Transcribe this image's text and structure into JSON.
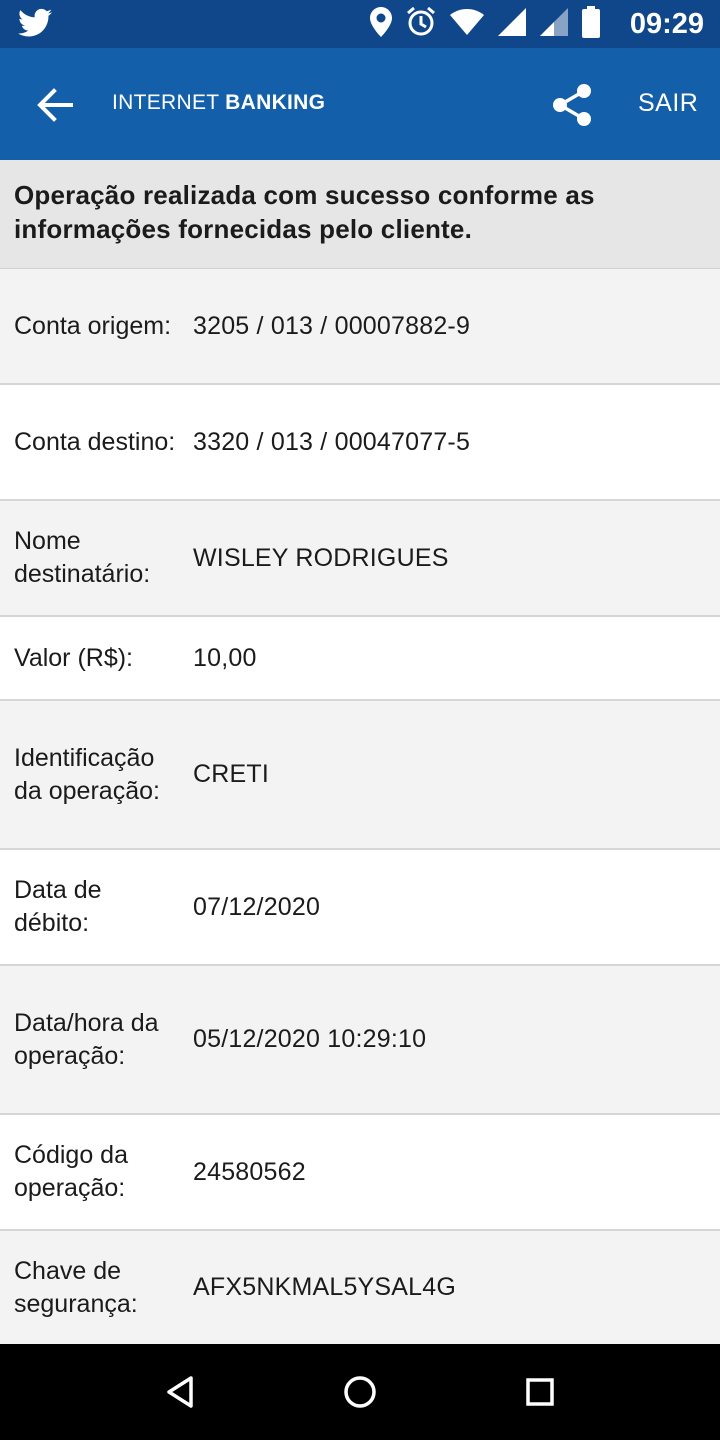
{
  "status_bar": {
    "time": "09:29",
    "icons": [
      "twitter-icon",
      "location-icon",
      "alarm-icon",
      "wifi-icon",
      "signal-icon",
      "signal-icon",
      "battery-icon"
    ]
  },
  "app_bar": {
    "title_prefix": "INTERNET",
    "title_bold": "BANKING",
    "exit_label": "SAIR",
    "colors": {
      "status_bar": "#10478a",
      "app_bar": "#135faa"
    }
  },
  "banner": {
    "message": "Operação realizada com sucesso conforme as informações fornecidas pelo cliente."
  },
  "details": [
    {
      "label": "Conta origem:",
      "value": "3205 / 013 / 00007882-9"
    },
    {
      "label": "Conta destino:",
      "value": "3320 / 013 / 00047077-5"
    },
    {
      "label": "Nome destinatário:",
      "value": "WISLEY RODRIGUES"
    },
    {
      "label": "Valor (R$):",
      "value": "10,00"
    },
    {
      "label": "Identificação da operação:",
      "value": "CRETI"
    },
    {
      "label": "Data de débito:",
      "value": "07/12/2020"
    },
    {
      "label": "Data/hora da operação:",
      "value": "05/12/2020 10:29:10"
    },
    {
      "label": "Código da operação:",
      "value": "24580562"
    },
    {
      "label": "Chave de segurança:",
      "value": "AFX5NKMAL5YSAL4G"
    }
  ],
  "nav_bar": {
    "buttons": [
      "back-icon",
      "home-icon",
      "recents-icon"
    ]
  }
}
